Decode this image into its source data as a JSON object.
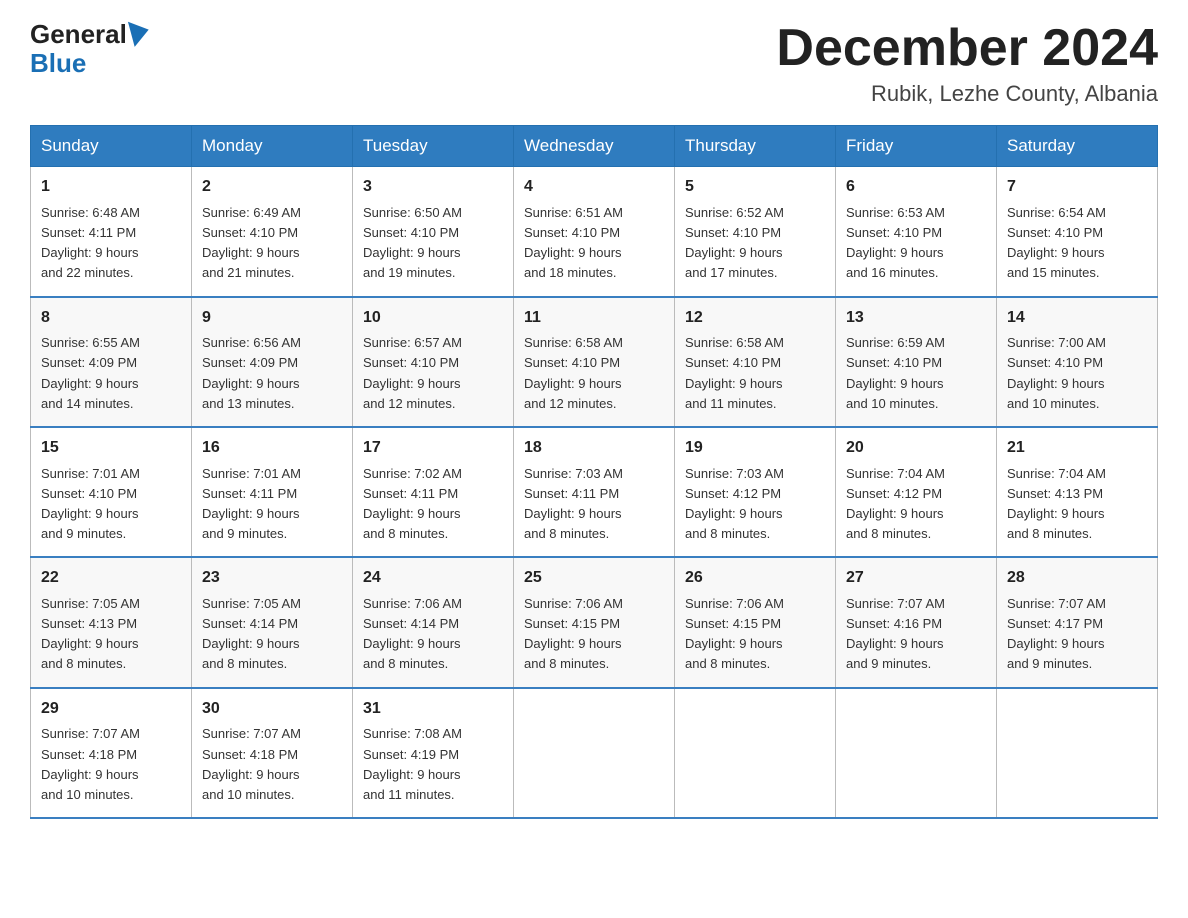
{
  "header": {
    "logo_general": "General",
    "logo_blue": "Blue",
    "month_title": "December 2024",
    "location": "Rubik, Lezhe County, Albania"
  },
  "weekdays": [
    "Sunday",
    "Monday",
    "Tuesday",
    "Wednesday",
    "Thursday",
    "Friday",
    "Saturday"
  ],
  "weeks": [
    [
      {
        "day": "1",
        "info": "Sunrise: 6:48 AM\nSunset: 4:11 PM\nDaylight: 9 hours\nand 22 minutes."
      },
      {
        "day": "2",
        "info": "Sunrise: 6:49 AM\nSunset: 4:10 PM\nDaylight: 9 hours\nand 21 minutes."
      },
      {
        "day": "3",
        "info": "Sunrise: 6:50 AM\nSunset: 4:10 PM\nDaylight: 9 hours\nand 19 minutes."
      },
      {
        "day": "4",
        "info": "Sunrise: 6:51 AM\nSunset: 4:10 PM\nDaylight: 9 hours\nand 18 minutes."
      },
      {
        "day": "5",
        "info": "Sunrise: 6:52 AM\nSunset: 4:10 PM\nDaylight: 9 hours\nand 17 minutes."
      },
      {
        "day": "6",
        "info": "Sunrise: 6:53 AM\nSunset: 4:10 PM\nDaylight: 9 hours\nand 16 minutes."
      },
      {
        "day": "7",
        "info": "Sunrise: 6:54 AM\nSunset: 4:10 PM\nDaylight: 9 hours\nand 15 minutes."
      }
    ],
    [
      {
        "day": "8",
        "info": "Sunrise: 6:55 AM\nSunset: 4:09 PM\nDaylight: 9 hours\nand 14 minutes."
      },
      {
        "day": "9",
        "info": "Sunrise: 6:56 AM\nSunset: 4:09 PM\nDaylight: 9 hours\nand 13 minutes."
      },
      {
        "day": "10",
        "info": "Sunrise: 6:57 AM\nSunset: 4:10 PM\nDaylight: 9 hours\nand 12 minutes."
      },
      {
        "day": "11",
        "info": "Sunrise: 6:58 AM\nSunset: 4:10 PM\nDaylight: 9 hours\nand 12 minutes."
      },
      {
        "day": "12",
        "info": "Sunrise: 6:58 AM\nSunset: 4:10 PM\nDaylight: 9 hours\nand 11 minutes."
      },
      {
        "day": "13",
        "info": "Sunrise: 6:59 AM\nSunset: 4:10 PM\nDaylight: 9 hours\nand 10 minutes."
      },
      {
        "day": "14",
        "info": "Sunrise: 7:00 AM\nSunset: 4:10 PM\nDaylight: 9 hours\nand 10 minutes."
      }
    ],
    [
      {
        "day": "15",
        "info": "Sunrise: 7:01 AM\nSunset: 4:10 PM\nDaylight: 9 hours\nand 9 minutes."
      },
      {
        "day": "16",
        "info": "Sunrise: 7:01 AM\nSunset: 4:11 PM\nDaylight: 9 hours\nand 9 minutes."
      },
      {
        "day": "17",
        "info": "Sunrise: 7:02 AM\nSunset: 4:11 PM\nDaylight: 9 hours\nand 8 minutes."
      },
      {
        "day": "18",
        "info": "Sunrise: 7:03 AM\nSunset: 4:11 PM\nDaylight: 9 hours\nand 8 minutes."
      },
      {
        "day": "19",
        "info": "Sunrise: 7:03 AM\nSunset: 4:12 PM\nDaylight: 9 hours\nand 8 minutes."
      },
      {
        "day": "20",
        "info": "Sunrise: 7:04 AM\nSunset: 4:12 PM\nDaylight: 9 hours\nand 8 minutes."
      },
      {
        "day": "21",
        "info": "Sunrise: 7:04 AM\nSunset: 4:13 PM\nDaylight: 9 hours\nand 8 minutes."
      }
    ],
    [
      {
        "day": "22",
        "info": "Sunrise: 7:05 AM\nSunset: 4:13 PM\nDaylight: 9 hours\nand 8 minutes."
      },
      {
        "day": "23",
        "info": "Sunrise: 7:05 AM\nSunset: 4:14 PM\nDaylight: 9 hours\nand 8 minutes."
      },
      {
        "day": "24",
        "info": "Sunrise: 7:06 AM\nSunset: 4:14 PM\nDaylight: 9 hours\nand 8 minutes."
      },
      {
        "day": "25",
        "info": "Sunrise: 7:06 AM\nSunset: 4:15 PM\nDaylight: 9 hours\nand 8 minutes."
      },
      {
        "day": "26",
        "info": "Sunrise: 7:06 AM\nSunset: 4:15 PM\nDaylight: 9 hours\nand 8 minutes."
      },
      {
        "day": "27",
        "info": "Sunrise: 7:07 AM\nSunset: 4:16 PM\nDaylight: 9 hours\nand 9 minutes."
      },
      {
        "day": "28",
        "info": "Sunrise: 7:07 AM\nSunset: 4:17 PM\nDaylight: 9 hours\nand 9 minutes."
      }
    ],
    [
      {
        "day": "29",
        "info": "Sunrise: 7:07 AM\nSunset: 4:18 PM\nDaylight: 9 hours\nand 10 minutes."
      },
      {
        "day": "30",
        "info": "Sunrise: 7:07 AM\nSunset: 4:18 PM\nDaylight: 9 hours\nand 10 minutes."
      },
      {
        "day": "31",
        "info": "Sunrise: 7:08 AM\nSunset: 4:19 PM\nDaylight: 9 hours\nand 11 minutes."
      },
      null,
      null,
      null,
      null
    ]
  ]
}
